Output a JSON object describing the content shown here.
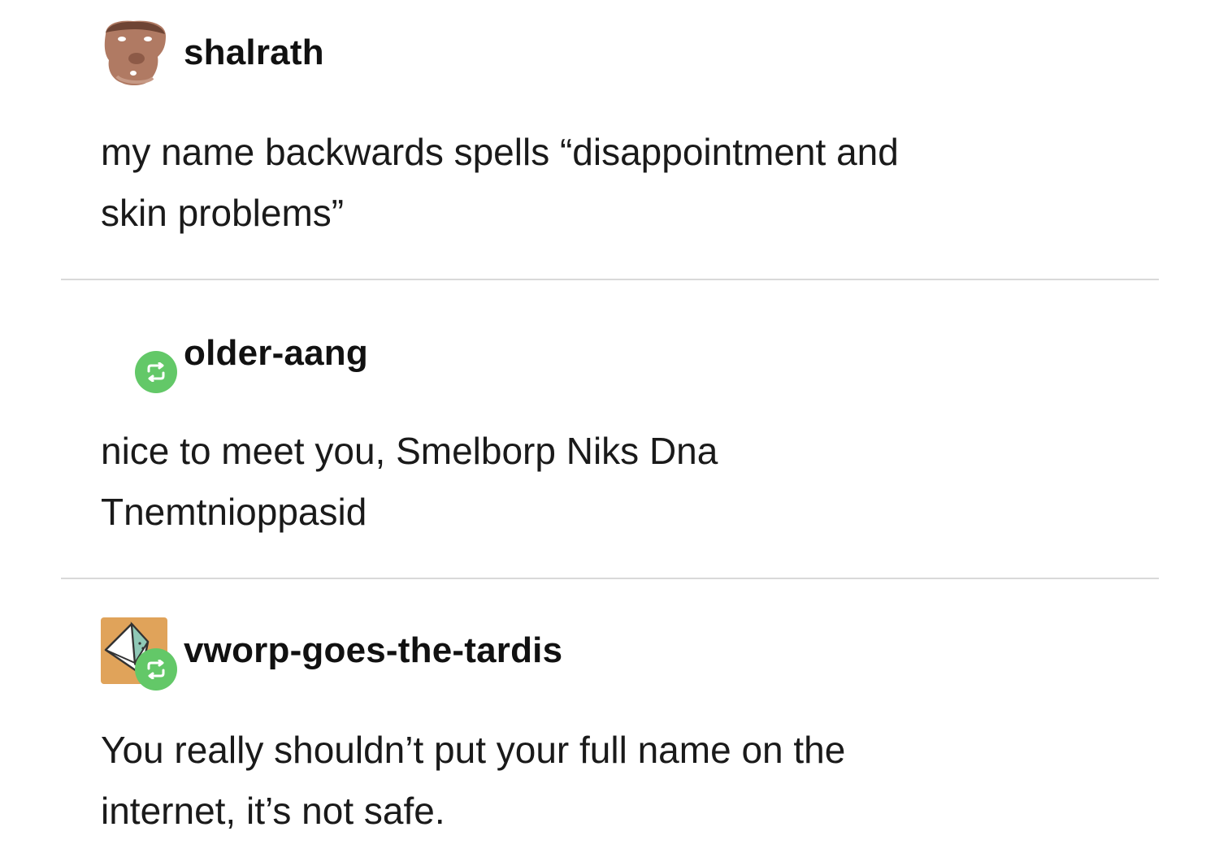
{
  "posts": [
    {
      "username": "shalrath",
      "avatar_icon": "brown-cat-avatar-icon",
      "reblog_badge": false,
      "body": [
        "my name backwards spells “disappointment and",
        "skin problems”"
      ]
    },
    {
      "username": "older-aang",
      "avatar_icon": "reblog-icon",
      "reblog_badge": true,
      "body": [
        "nice to meet you, Smelborp Niks Dna",
        "Tnemtnioppasid"
      ]
    },
    {
      "username": "vworp-goes-the-tardis",
      "avatar_icon": "tardis-sketch-avatar-icon",
      "reblog_badge": true,
      "body": [
        "You really shouldn’t put your full name on the",
        "internet, it’s not safe."
      ]
    }
  ],
  "colors": {
    "reblog_green": "#63c868",
    "divider": "#d9d9d9",
    "text": "#1a1a1a",
    "tardis_avatar_bg": "#e0a35a"
  }
}
